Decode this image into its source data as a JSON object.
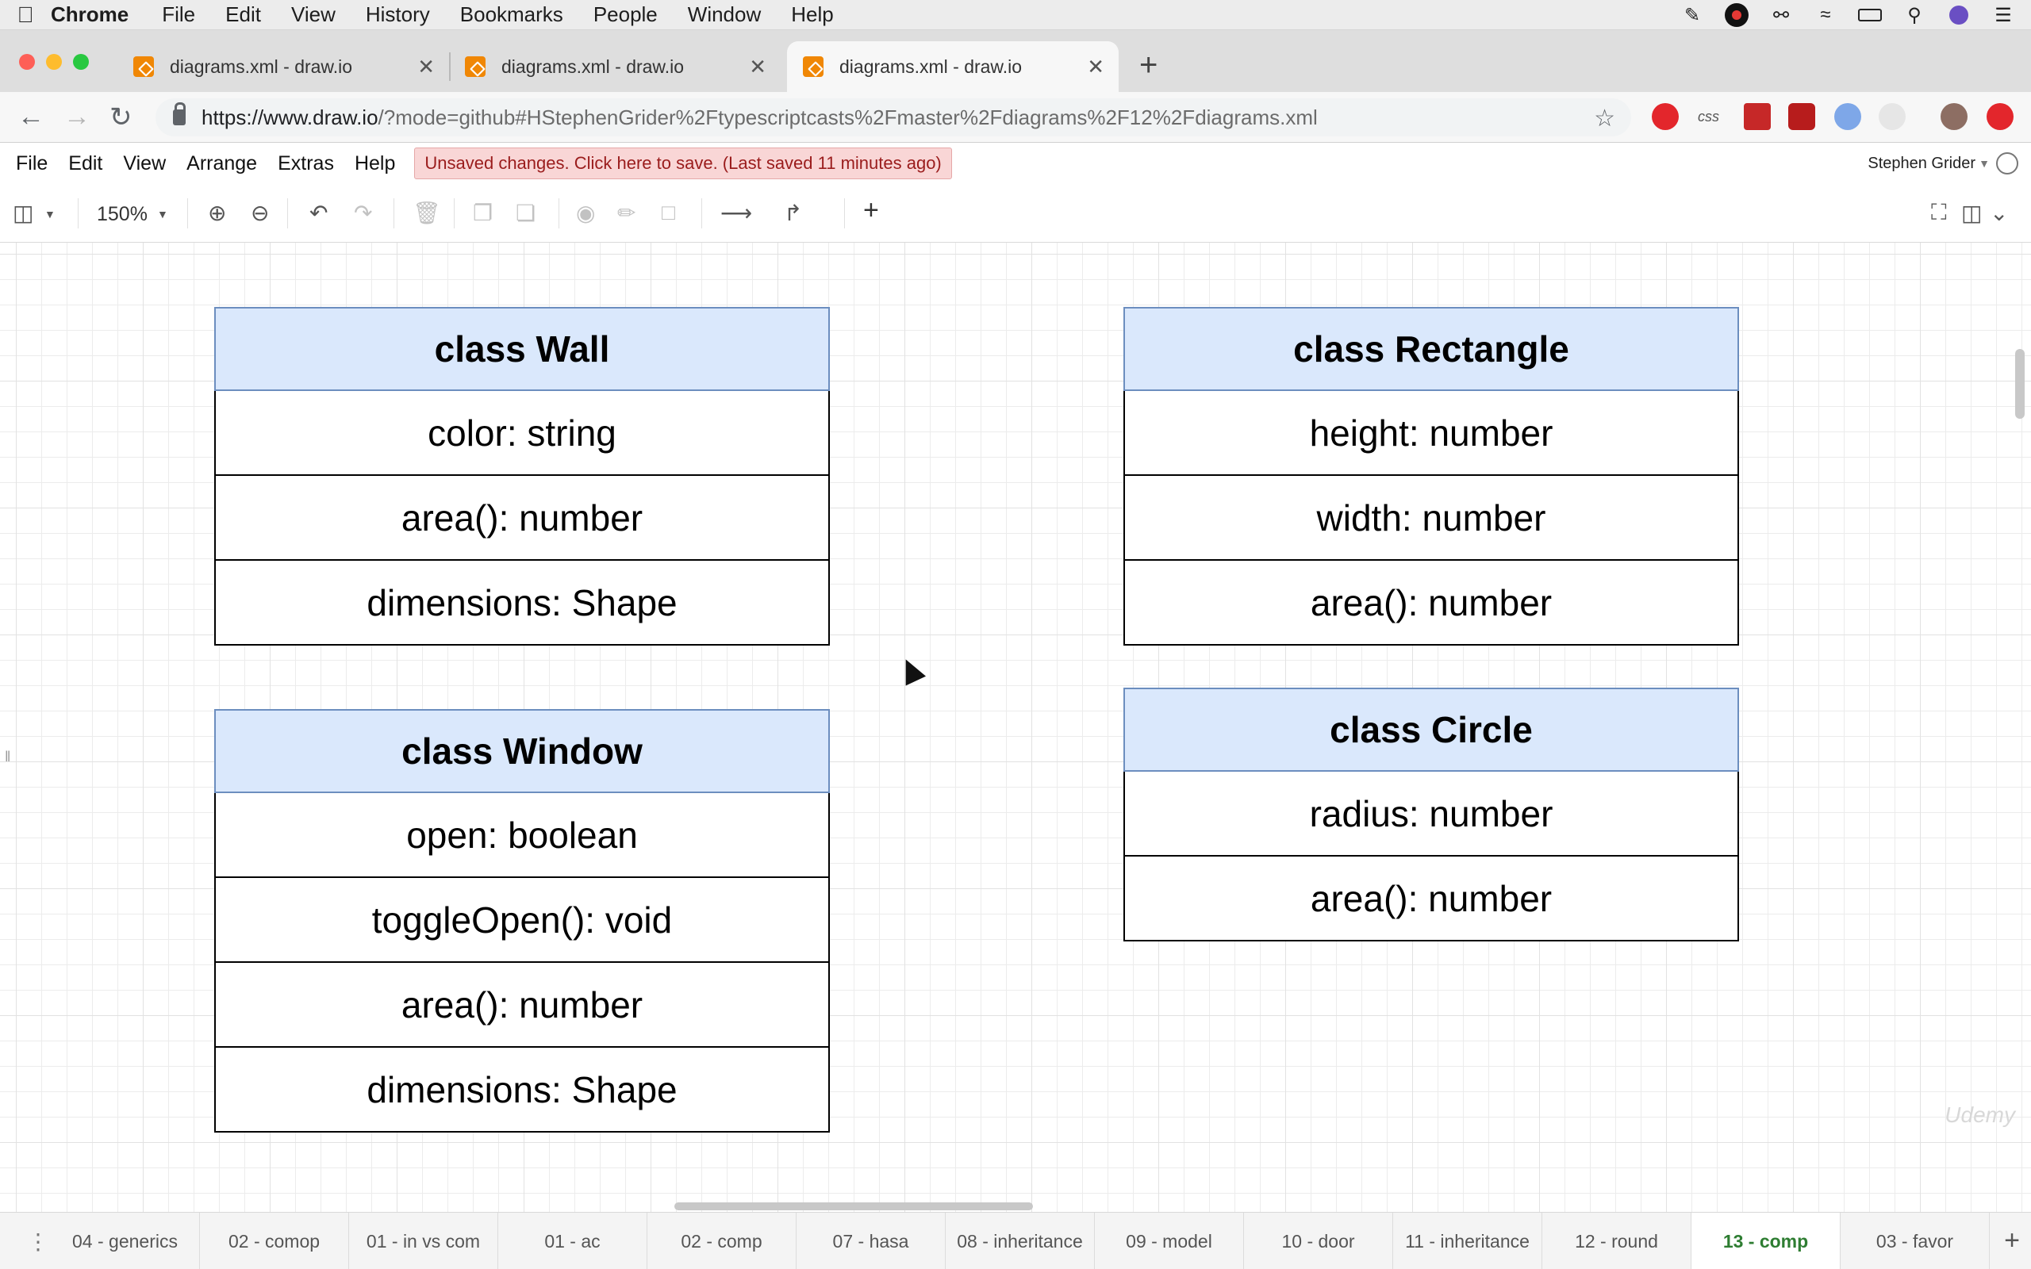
{
  "mac": {
    "app_name": "Chrome",
    "menus": [
      "File",
      "Edit",
      "View",
      "History",
      "Bookmarks",
      "People",
      "Window",
      "Help"
    ]
  },
  "browser": {
    "tabs": [
      {
        "title": "diagrams.xml - draw.io",
        "active": false
      },
      {
        "title": "diagrams.xml - draw.io",
        "active": false
      },
      {
        "title": "diagrams.xml - draw.io",
        "active": true
      }
    ],
    "url_host": "https://www.draw.io",
    "url_rest": "/?mode=github#HStephenGrider%2Ftypescriptcasts%2Fmaster%2Fdiagrams%2F12%2Fdiagrams.xml"
  },
  "drawio": {
    "menus": [
      "File",
      "Edit",
      "View",
      "Arrange",
      "Extras",
      "Help"
    ],
    "unsaved_notice": "Unsaved changes. Click here to save. (Last saved 11 minutes ago)",
    "user": "Stephen Grider",
    "zoom": "150%"
  },
  "diagram": {
    "wall": {
      "title": "class Wall",
      "rows": [
        "color: string",
        "area(): number",
        "dimensions: Shape"
      ]
    },
    "window": {
      "title": "class Window",
      "rows": [
        "open: boolean",
        "toggleOpen(): void",
        "area(): number",
        "dimensions: Shape"
      ]
    },
    "rectangle": {
      "title": "class Rectangle",
      "rows": [
        "height: number",
        "width: number",
        "area(): number"
      ]
    },
    "circle": {
      "title": "class Circle",
      "rows": [
        "radius: number",
        "area(): number"
      ]
    }
  },
  "watermark": "Udemy",
  "pages": [
    {
      "label": "04 - generics",
      "active": false
    },
    {
      "label": "02 - comop",
      "active": false
    },
    {
      "label": "01 - in vs com",
      "active": false
    },
    {
      "label": "01 - ac",
      "active": false
    },
    {
      "label": "02 - comp",
      "active": false
    },
    {
      "label": "07 - hasa",
      "active": false
    },
    {
      "label": "08 - inheritance",
      "active": false
    },
    {
      "label": "09 - model",
      "active": false
    },
    {
      "label": "10 - door",
      "active": false
    },
    {
      "label": "11 - inheritance",
      "active": false
    },
    {
      "label": "12 - round",
      "active": false
    },
    {
      "label": "13 - comp",
      "active": true
    },
    {
      "label": "03 - favor",
      "active": false
    }
  ],
  "colors": {
    "header_fill": "#dae8fc",
    "header_stroke": "#6c8ebf",
    "active_page": "#2e7d32",
    "unsaved_bg": "#f9d6d6"
  }
}
